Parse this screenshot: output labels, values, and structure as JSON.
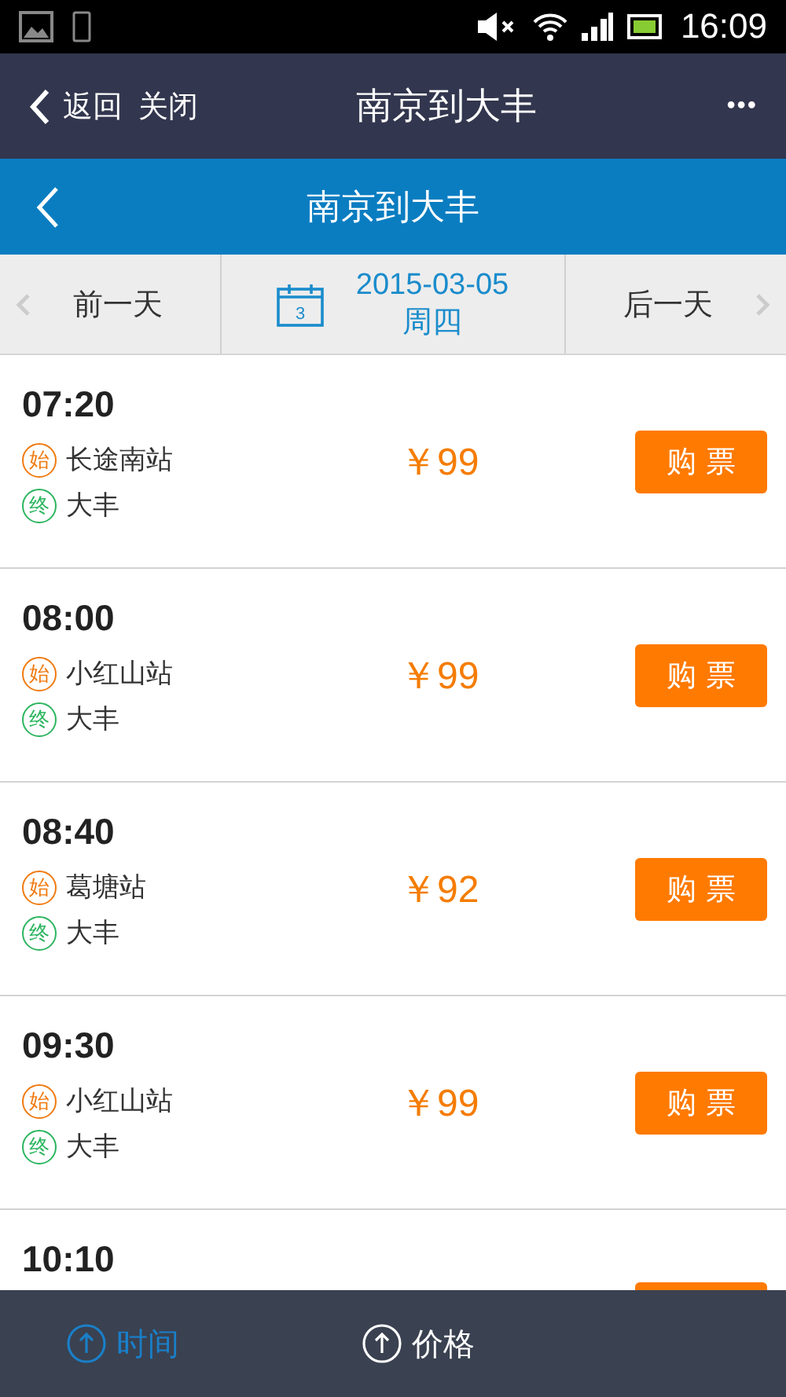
{
  "status_bar": {
    "time": "16:09"
  },
  "nav_bar": {
    "back": "返回",
    "close": "关闭",
    "title": "南京到大丰",
    "more": "•••"
  },
  "header": {
    "title": "南京到大丰"
  },
  "date_bar": {
    "prev": "前一天",
    "calendar_day": "3",
    "date": "2015-03-05",
    "weekday": "周四",
    "next": "后一天"
  },
  "trips": [
    {
      "kind": "full",
      "time": "07:20",
      "start_tag": "始",
      "start": "长途南站",
      "end_tag": "终",
      "end": "大丰",
      "price": "￥99",
      "buy": "购 票"
    },
    {
      "kind": "full",
      "time": "08:00",
      "start_tag": "始",
      "start": "小红山站",
      "end_tag": "终",
      "end": "大丰",
      "price": "￥99",
      "buy": "购 票"
    },
    {
      "kind": "full",
      "time": "08:40",
      "start_tag": "始",
      "start": "葛塘站",
      "end_tag": "终",
      "end": "大丰",
      "price": "￥92",
      "buy": "购 票"
    },
    {
      "kind": "full",
      "time": "09:30",
      "start_tag": "始",
      "start": "小红山站",
      "end_tag": "终",
      "end": "大丰",
      "price": "￥99",
      "buy": "购 票"
    },
    {
      "kind": "partial",
      "time": "10:10"
    }
  ],
  "sort_bar": [
    {
      "label": "时间",
      "selected": true
    },
    {
      "label": "价格",
      "selected": false
    }
  ]
}
